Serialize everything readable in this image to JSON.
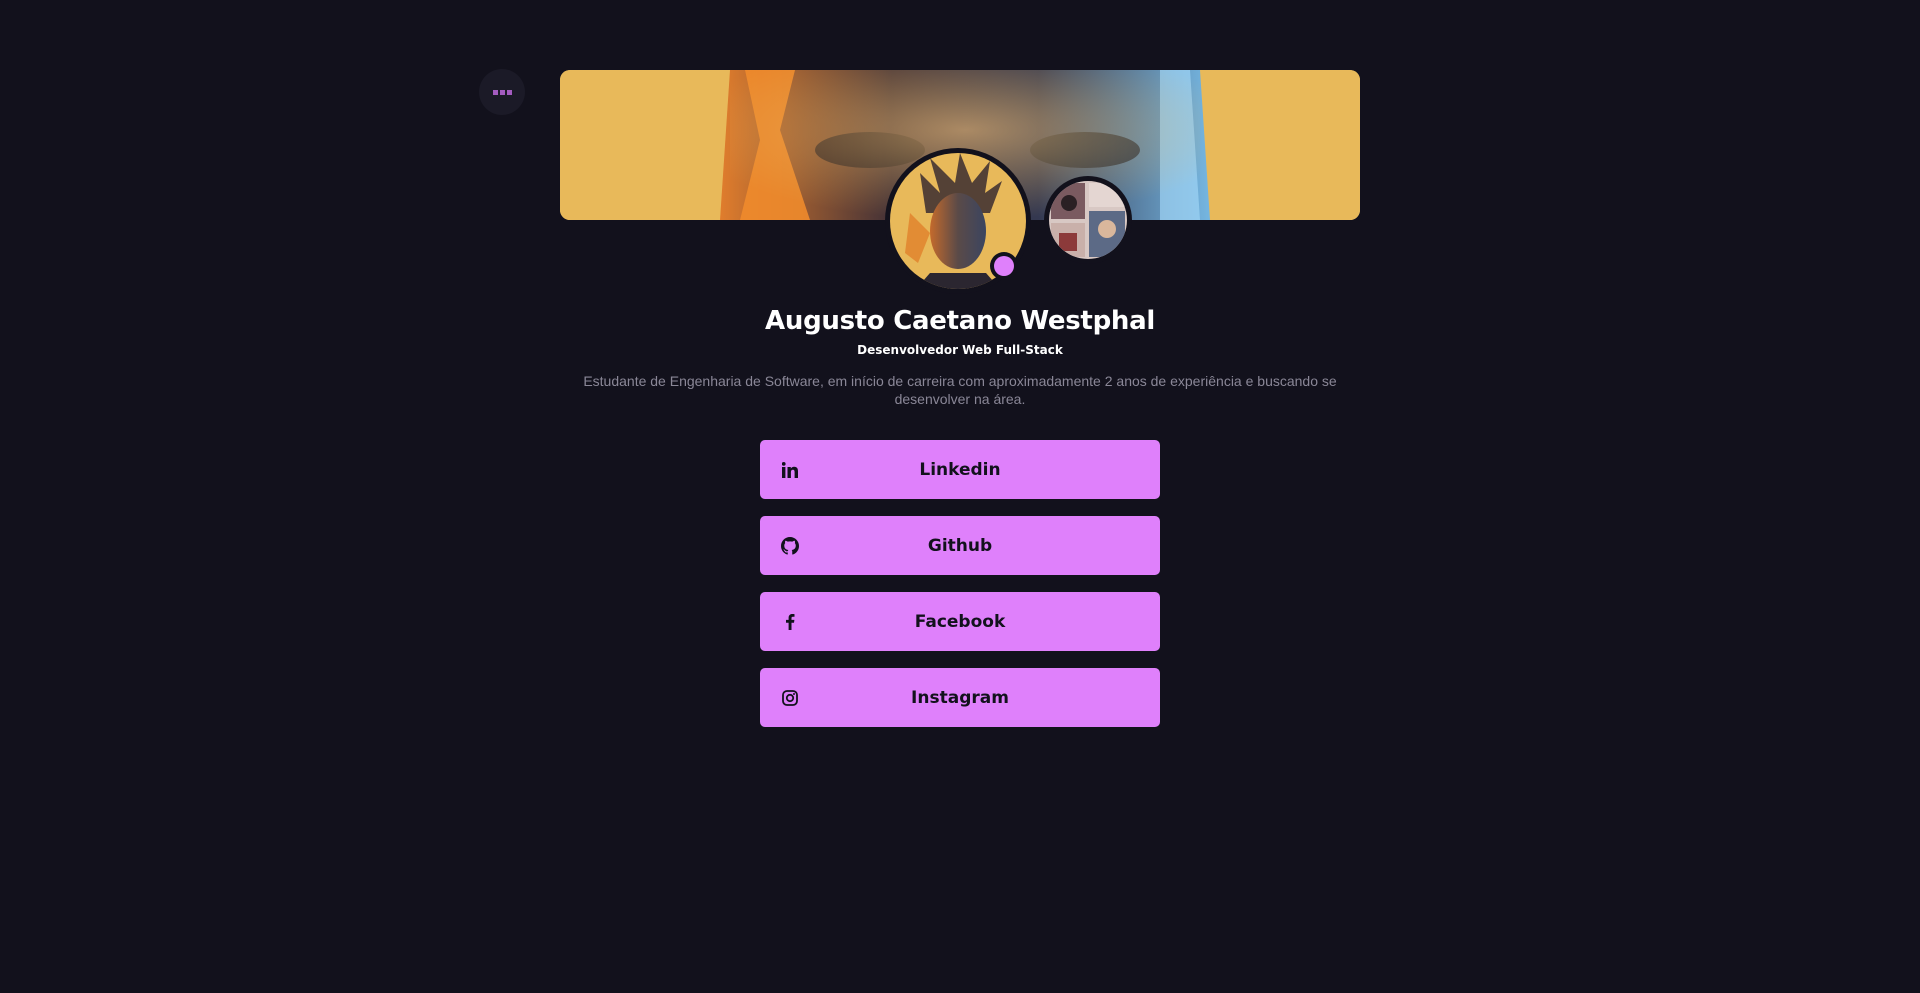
{
  "menu": {
    "icon": "more-icon"
  },
  "profile": {
    "name": "Augusto Caetano Westphal",
    "role": "Desenvolvedor Web Full-Stack",
    "bio": "Estudante de Engenharia de Software, em início de carreira com aproximadamente 2 anos de experiência e buscando se desenvolver na área."
  },
  "links": [
    {
      "label": "Linkedin",
      "icon": "linkedin-icon"
    },
    {
      "label": "Github",
      "icon": "github-icon"
    },
    {
      "label": "Facebook",
      "icon": "facebook-icon"
    },
    {
      "label": "Instagram",
      "icon": "instagram-icon"
    }
  ],
  "colors": {
    "background": "#12111c",
    "accent": "#df80fb",
    "banner": "#e8b95a",
    "text": "#ffffff",
    "muted": "#8a8797"
  }
}
